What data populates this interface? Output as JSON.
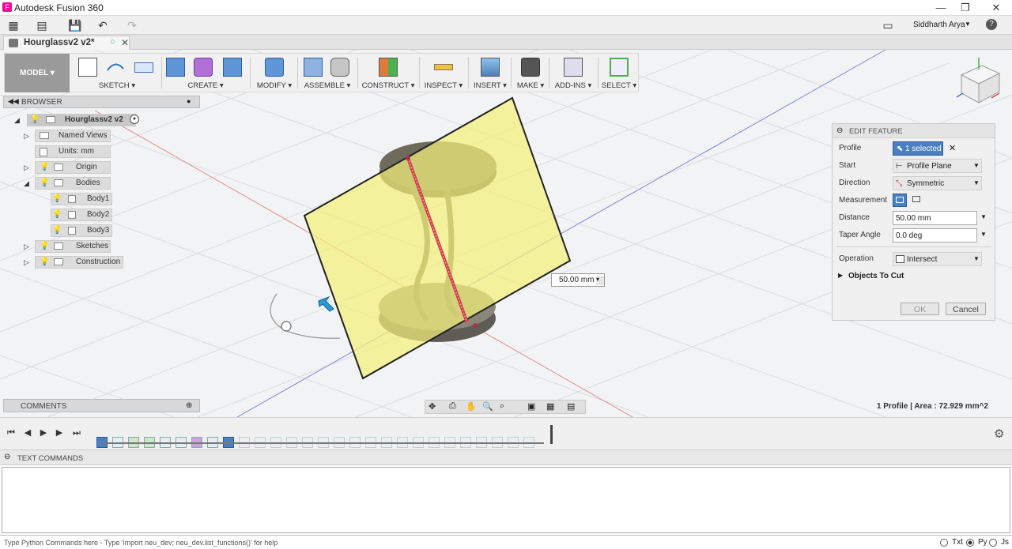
{
  "titlebar": {
    "title": "Autodesk Fusion 360",
    "minimize": "—",
    "restore": "❐",
    "close": "✕"
  },
  "menubar": {
    "user": "Siddharth Arya",
    "help": "?"
  },
  "tab": {
    "label": "Hourglassv2 v2*"
  },
  "ribbon": {
    "model": "MODEL ▾",
    "groups": [
      "SKETCH ▾",
      "CREATE ▾",
      "MODIFY ▾",
      "ASSEMBLE ▾",
      "CONSTRUCT ▾",
      "INSPECT ▾",
      "INSERT ▾",
      "MAKE ▾",
      "ADD-INS ▾",
      "SELECT ▾"
    ]
  },
  "browser": {
    "title": "BROWSER",
    "root": "Hourglassv2 v2",
    "items": [
      {
        "label": "Named Views"
      },
      {
        "label": "Units: mm"
      },
      {
        "label": "Origin"
      },
      {
        "label": "Bodies"
      },
      {
        "label": "Body1"
      },
      {
        "label": "Body2"
      },
      {
        "label": "Body3"
      },
      {
        "label": "Sketches"
      },
      {
        "label": "Construction"
      }
    ]
  },
  "viewcube": {
    "front": "FRONT",
    "right": "RIGHT",
    "z": "Z",
    "x": "X",
    "y": "Y"
  },
  "dimension": {
    "value": "50.00 mm"
  },
  "edit_feature": {
    "title": "EDIT FEATURE",
    "profile_label": "Profile",
    "profile_value": "1 selected",
    "start_label": "Start",
    "start_value": "Profile Plane",
    "direction_label": "Direction",
    "direction_value": "Symmetric",
    "measurement_label": "Measurement",
    "distance_label": "Distance",
    "distance_value": "50.00 mm",
    "taper_label": "Taper Angle",
    "taper_value": "0.0 deg",
    "operation_label": "Operation",
    "operation_value": "Intersect",
    "objects_to_cut": "Objects To Cut",
    "ok": "OK",
    "cancel": "Cancel"
  },
  "comments": {
    "title": "COMMENTS"
  },
  "status": {
    "text": "1 Profile | Area : 72.929 mm^2"
  },
  "text_commands": {
    "title": "TEXT COMMANDS",
    "placeholder": "Type Python Commands here - Type 'import neu_dev; neu_dev.list_functions()' for help"
  },
  "cmd_modes": [
    "Txt",
    "Py",
    "Js"
  ],
  "colors": {
    "accent": "#4a7fc1",
    "plane": "#f4f07a",
    "body": "#6b6752",
    "axis": "#d23a4a"
  }
}
